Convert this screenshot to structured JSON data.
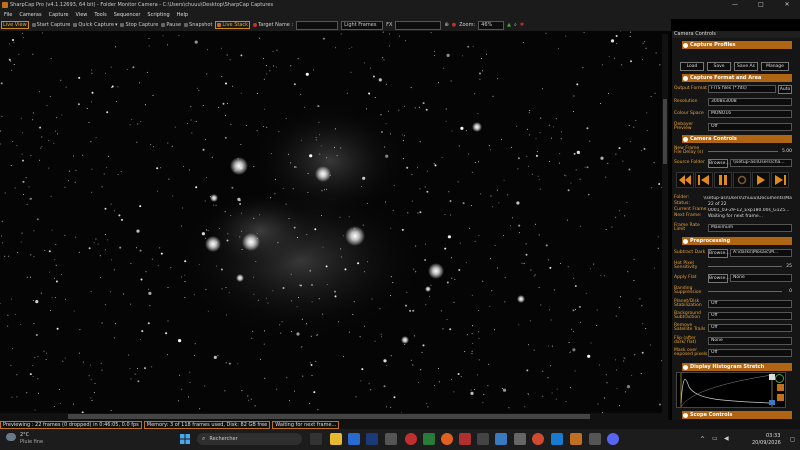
{
  "window": {
    "title": "SharpCap Pro (v4.1.12693, 64 bit) - Folder Monitor Camera - C:\\Users\\chuuu\\Desktop\\SharpCap Captures",
    "min": "—",
    "max": "□",
    "close": "✕"
  },
  "menu": [
    "File",
    "Cameras",
    "Capture",
    "View",
    "Tools",
    "Sequencer",
    "Scripting",
    "Help"
  ],
  "toolbar": {
    "live_view": "Live View",
    "start_capture": "Start Capture",
    "quick_capture": "Quick Capture",
    "stop_capture": "Stop Capture",
    "pause": "Pause",
    "snapshot": "Snapshot",
    "live_stack": "Live Stack",
    "target_name": "Target Name :",
    "frame_type": "Light Frames",
    "fx": "FX",
    "zoom_label": "Zoom:",
    "zoom_value": "46%"
  },
  "status": {
    "frames": "Previewing : 22 frames (0 dropped) in 0:46:05, 0.0 fps",
    "memory": "Memory: 3 of 118 frames used, Disk: 82 GB free",
    "waiting": "Waiting for next frame..."
  },
  "panel": {
    "title": "Camera Controls",
    "capture_profiles": {
      "title": "Capture Profiles",
      "load": "Load",
      "save": "Save",
      "save_as": "Save As",
      "manage": "Manage"
    },
    "capture_format": {
      "title": "Capture Format and Area",
      "output_format_label": "Output Format",
      "output_format": "FITS files (*.fits)",
      "auto": "Auto",
      "resolution_label": "Resolution",
      "resolution": "3008x3008",
      "colour_space_label": "Colour Space",
      "colour_space": "MONO16",
      "debayer_label": "Debayer Preview",
      "debayer": "Off"
    },
    "camera_controls": {
      "title": "Camera Controls",
      "new_frame_label": "New Frame File Delay (s)",
      "new_frame_value": "5.00",
      "source_folder_label": "Source Folder",
      "browse": "Browse...",
      "source_folder": "\\\\setup-asi\\Users\\cha...",
      "folder_label": "Folder:",
      "folder": "\\\\setup-asi\\Users\\chuuu\\Documents\\Manual...",
      "status_label": "Status:",
      "status": "22 of 22",
      "current_frame_label": "Current Frame:",
      "current_frame": "0001_03-29-12_Exp180.00s_G125...",
      "next_frame_label": "Next Frame:",
      "next_frame": "Waiting for next frame...",
      "frame_rate_label": "Frame Rate Limit",
      "frame_rate": "Maximum"
    },
    "preprocessing": {
      "title": "Preprocessing",
      "subtract_dark_label": "Subtract Dark",
      "subtract_dark": "A:\\darks\\Mosaic\\M...",
      "hot_pixel_label": "Hot Pixel Sensitivity",
      "hot_pixel": "25",
      "apply_flat_label": "Apply Flat",
      "apply_flat": "None",
      "banding_label": "Banding Suppression",
      "banding": "0",
      "planet_label": "Planet/Disk Stabilization",
      "planet": "Off",
      "background_label": "Background Subtraction",
      "background": "Off",
      "satellite_label": "Remove Satellite Trails",
      "satellite": "Off",
      "flip_label": "Flip (after dark/ flat)",
      "flip": "None",
      "mask_label": "Mask over exposed pixels",
      "mask": "Off"
    },
    "histogram": {
      "title": "Display Histogram Stretch"
    },
    "scope": {
      "title": "Scope Controls"
    }
  },
  "taskbar": {
    "temp": "2°C",
    "weather": "Pluie fine",
    "search": "Rechercher",
    "time": "03:33",
    "date": "20/09/2026"
  }
}
